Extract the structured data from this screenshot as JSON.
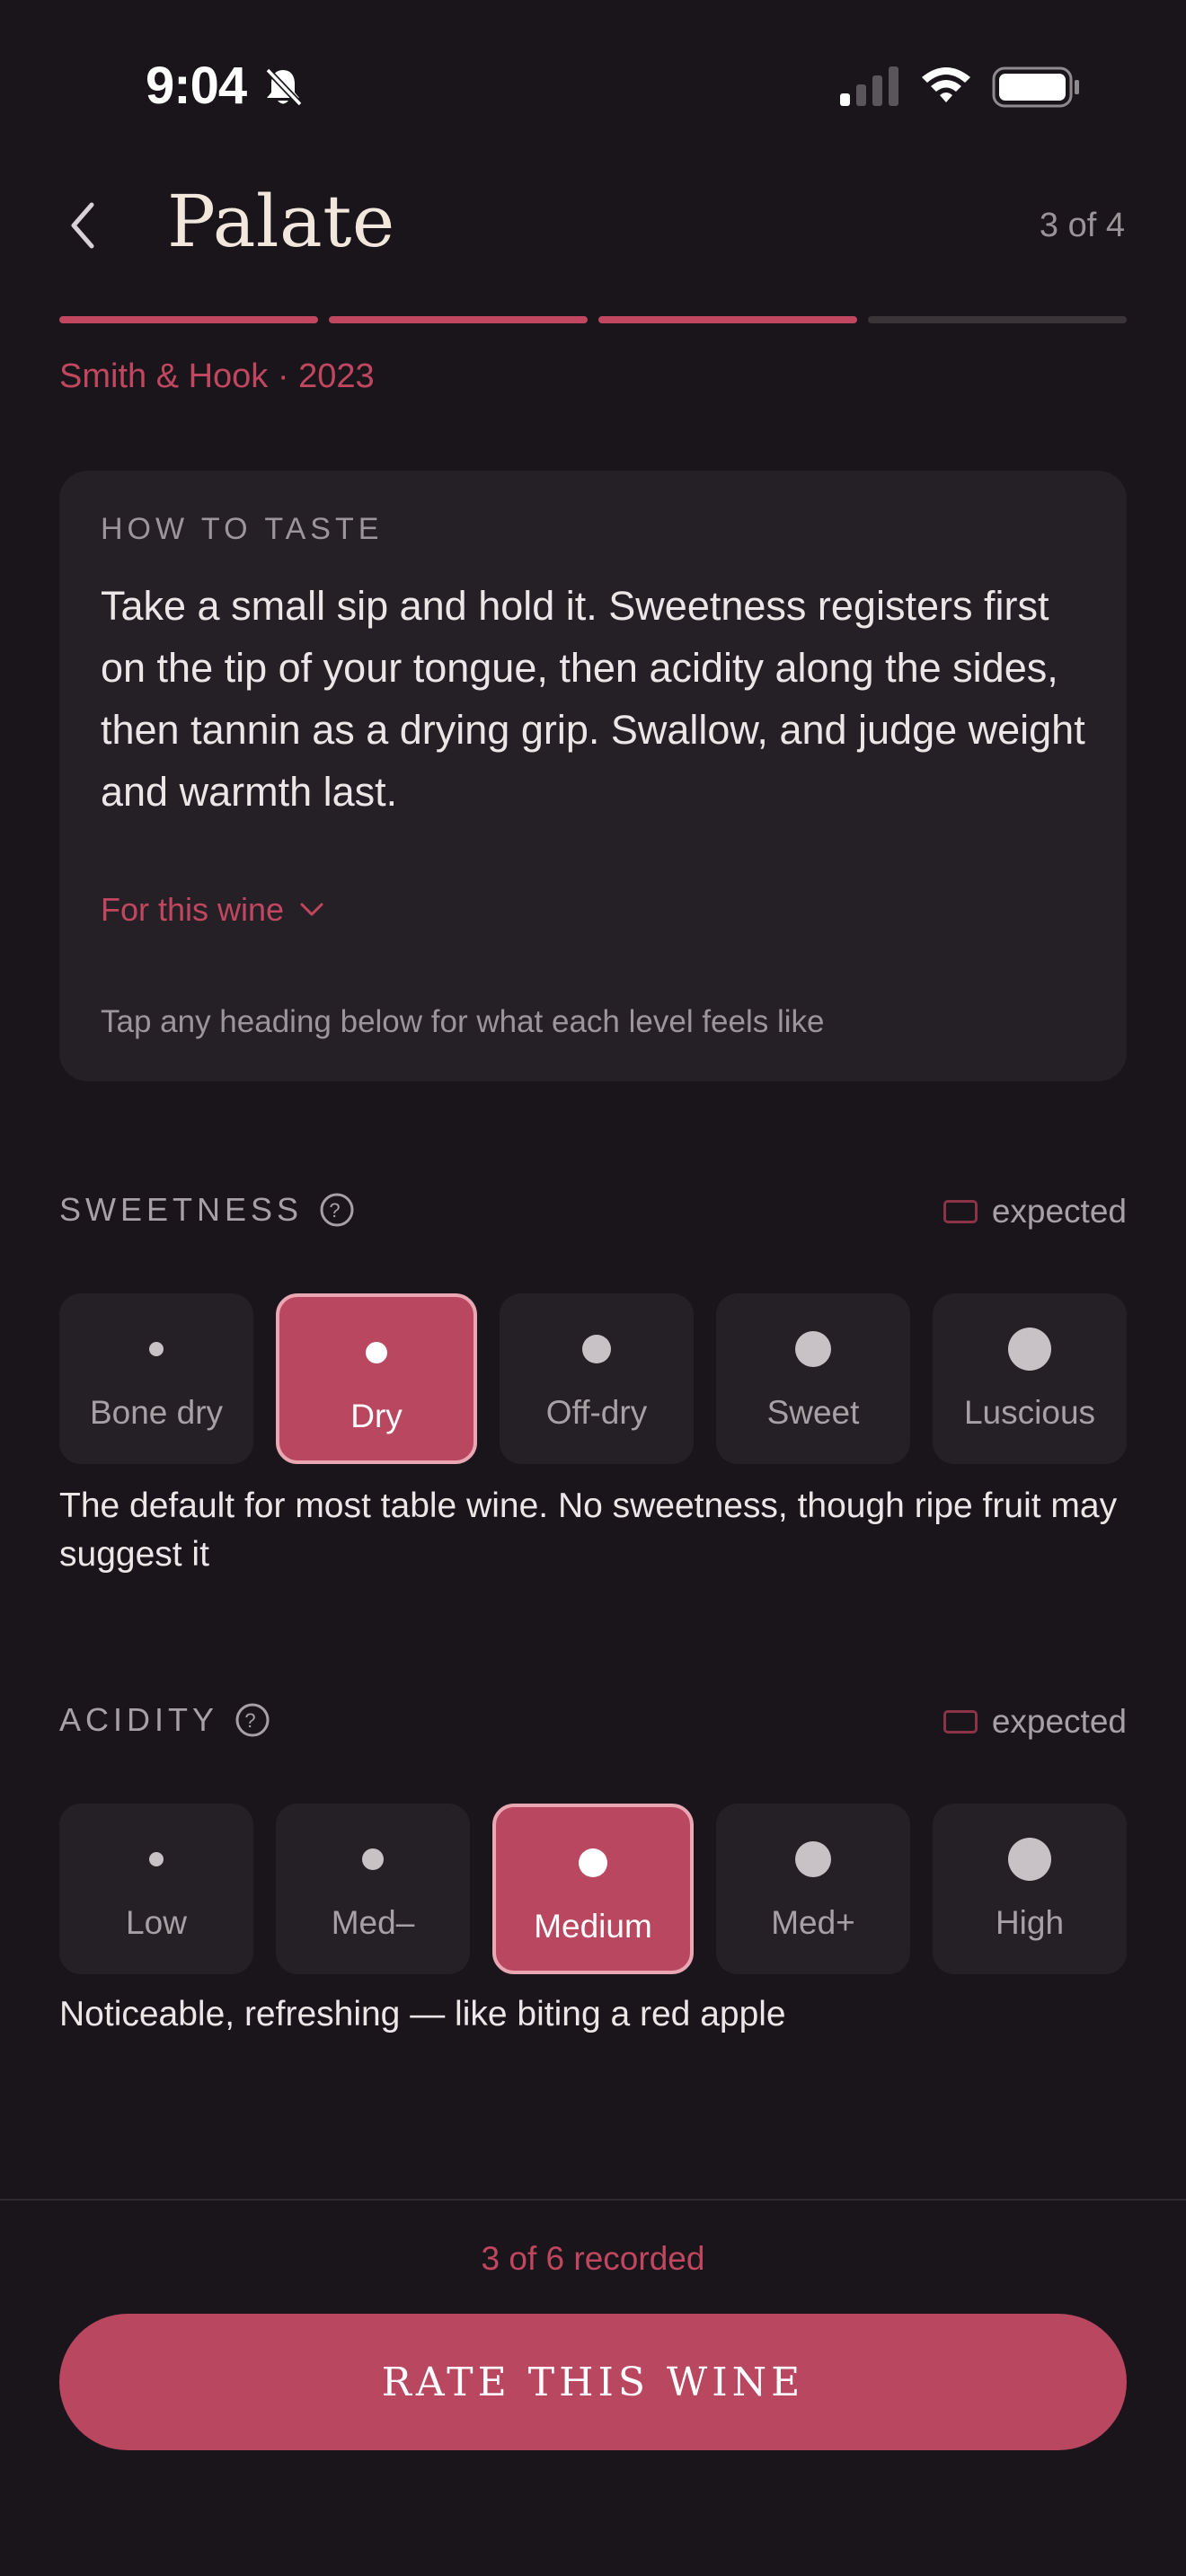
{
  "status_bar": {
    "time": "9:04",
    "icons": [
      "bell-slash-icon",
      "signal-icon",
      "wifi-icon",
      "battery-icon"
    ]
  },
  "header": {
    "title": "Palate",
    "step": "3 of 4",
    "back_icon": "chevron-left-icon"
  },
  "progress": {
    "total_steps": 4,
    "completed_steps": 3
  },
  "wine": {
    "name": "Smith & Hook · 2023"
  },
  "how_to_taste": {
    "heading": "HOW TO TASTE",
    "body": "Take a small sip and hold it. Sweetness registers first on the tip of your tongue, then acidity along the sides, then tannin as a drying grip. Swallow, and judge weight and warmth last.",
    "for_this_wine": "For this wine",
    "hint": "Tap any heading below for what each level feels like"
  },
  "sweetness": {
    "label": "SWEETNESS",
    "legend": "expected",
    "options": [
      "Bone dry",
      "Dry",
      "Off-dry",
      "Sweet",
      "Luscious"
    ],
    "selected": "Dry",
    "description": "The default for most table wine. No sweetness, though ripe fruit may suggest it"
  },
  "acidity": {
    "label": "ACIDITY",
    "legend": "expected",
    "options": [
      "Low",
      "Med–",
      "Medium",
      "Med+",
      "High"
    ],
    "selected": "Medium",
    "description": "Noticeable, refreshing — like biting a red apple"
  },
  "footer": {
    "recorded": "3 of 6 recorded",
    "button": "RATE THIS WINE"
  },
  "colors": {
    "accent": "#c0475f",
    "background": "#1a151a",
    "card": "#252025",
    "title": "#f1e7dc"
  }
}
